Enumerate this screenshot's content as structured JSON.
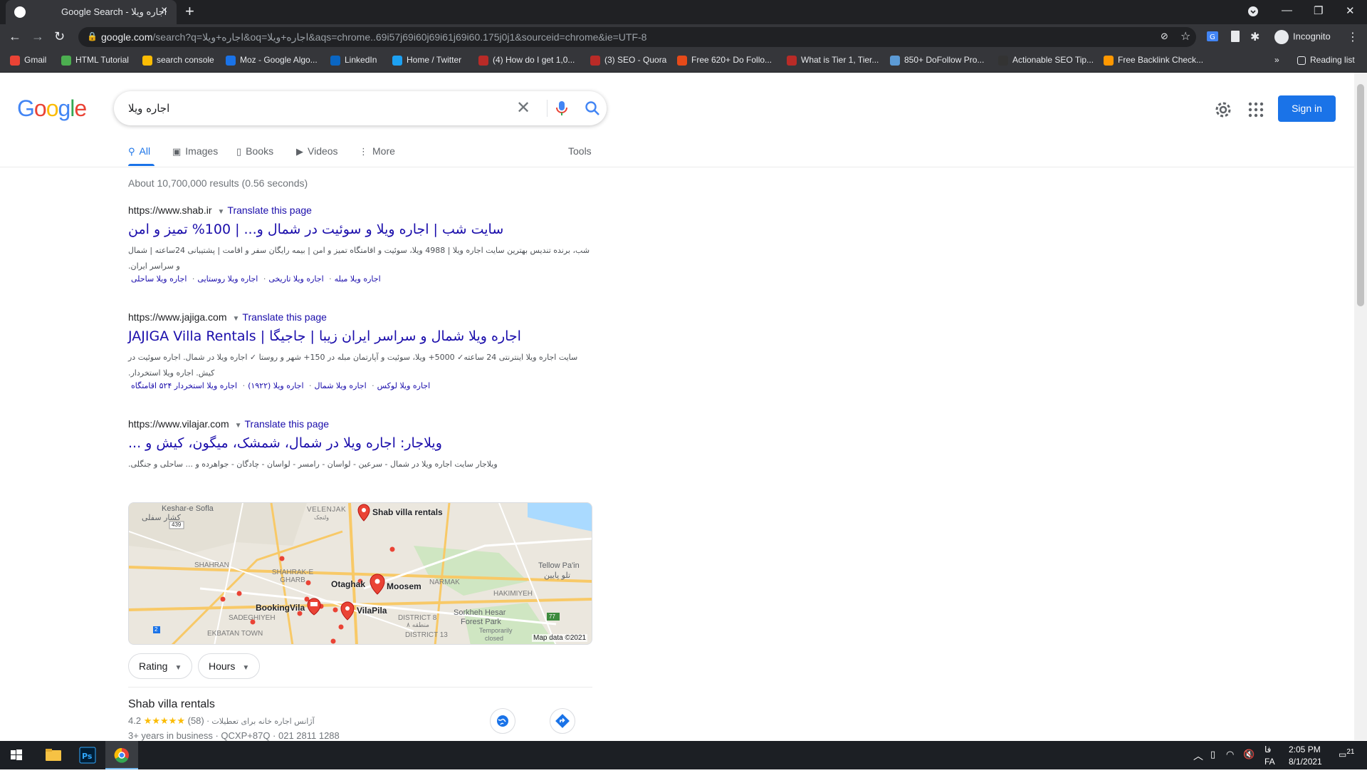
{
  "browser": {
    "tab_title": "Google Search - اجاره ویلا",
    "new_tab": "+",
    "url_host": "google.com",
    "url_rest": "/search?q=اجاره+ویلا&oq=اجاره+ویلا&aqs=chrome..69i57j69i60j69i61j69i60.175j0j1&sourceid=chrome&ie=UTF-8",
    "incognito_label": "Incognito",
    "bookmarks": [
      {
        "label": "Gmail",
        "color": "#ea4335"
      },
      {
        "label": "HTML Tutorial",
        "color": "#4caf50"
      },
      {
        "label": "search console",
        "color": "#fbbc04"
      },
      {
        "label": "Moz - Google Algo...",
        "color": "#1a73e8"
      },
      {
        "label": "LinkedIn",
        "color": "#0a66c2"
      },
      {
        "label": "Home / Twitter",
        "color": "#1da1f2"
      },
      {
        "label": "(4) How do I get 1,0...",
        "color": "#b92b27"
      },
      {
        "label": "(3) SEO - Quora",
        "color": "#b92b27"
      },
      {
        "label": "Free 620+ Do Follo...",
        "color": "#e64a19"
      },
      {
        "label": "What is Tier 1, Tier...",
        "color": "#b92b27"
      },
      {
        "label": "850+ DoFollow Pro...",
        "color": "#5c9bd6"
      },
      {
        "label": "Actionable SEO Tip...",
        "color": "#333333"
      },
      {
        "label": "Free Backlink Check...",
        "color": "#ff9800"
      }
    ],
    "bookmarks_more": "»",
    "reading_list": "Reading list"
  },
  "google": {
    "logo_letters": [
      "G",
      "o",
      "o",
      "g",
      "l",
      "e"
    ],
    "query": "اجاره ویلا",
    "sign_in": "Sign in",
    "tabs": [
      {
        "label": "All",
        "icon": "search-icon"
      },
      {
        "label": "Images",
        "icon": "image-icon"
      },
      {
        "label": "Books",
        "icon": "book-icon"
      },
      {
        "label": "Videos",
        "icon": "video-icon"
      },
      {
        "label": "More",
        "icon": "more-vert-icon"
      }
    ],
    "tools": "Tools",
    "stats": "About 10,700,000 results (0.56 seconds)"
  },
  "results": [
    {
      "url": "https://www.shab.ir",
      "translate": "Translate this page",
      "title": "سایت شب | اجاره ویلا و سوئیت در شمال و... | 100% تمیز و امن",
      "snippet": "شب، برنده تندیس بهترین سایت اجاره ویلا | 4988 ویلا، سوئیت و اقامتگاه تمیز و امن | بیمه رایگان سفر و اقامت | پشتیبانی 24ساعته | شمال و سراسر ایران.",
      "sitelinks": [
        "اجاره ویلا مبله",
        "اجاره ویلا تاریخی",
        "اجاره ویلا روستایی",
        "اجاره ویلا ساحلی"
      ]
    },
    {
      "url": "https://www.jajiga.com",
      "translate": "Translate this page",
      "title": "اجاره ویلا شمال و سراسر ایران زیبا | جاجیگا | JAJIGA Villa Rentals",
      "snippet": "سایت اجاره ویلا اینترنتی 24 ساعته✓ 5000+ ویلا، سوئیت و آپارتمان مبله در 150+ شهر و روستا ✓ اجاره ویلا در شمال. اجاره سوئیت در کیش. اجاره ویلا استخردار.",
      "sitelinks": [
        "اجاره ویلا لوکس",
        "اجاره ویلا شمال",
        "اجاره ویلا (۱۹۲۲)",
        "اجاره ویلا استخردار ۵۲۴ اقامتگاه"
      ]
    },
    {
      "url": "https://www.vilajar.com",
      "translate": "Translate this page",
      "title": "ویلاجار: اجاره ویلا در شمال، شمشک، میگون، کیش و ...",
      "snippet": "ویلاجار سایت اجاره ویلا در شمال - سرعین - لواسان - رامسر - لواسان - چادگان - جواهرده و ... ساحلی و جنگلی.",
      "sitelinks": []
    }
  ],
  "map": {
    "labels": {
      "keshar_en": "Keshar-e Sofla",
      "keshar_fa": "کشار سفلی",
      "road439": "439",
      "velenjak": "VELENJAK",
      "velenjak_fa": "ولنجک",
      "shab": "Shab villa rentals",
      "shahran": "SHAHRAN",
      "shahrak": "SHAHRAK-E GHARB",
      "otaghak": "Otaghak",
      "moosem": "Moosem",
      "narmak": "NARMAK",
      "hakimiyeh": "HAKIMIYEH",
      "tellow": "Tellow Pa'in",
      "tellow_fa": "تلو پایین",
      "bookingvila": "BookingVila",
      "vilapila": "VilaPila",
      "sadeghiyeh": "SADEGHIYEH",
      "ekbatan": "EKBATAN TOWN",
      "district8": "DISTRICT 8",
      "district8_fa": "منطقه ۸",
      "district13": "DISTRICT 13",
      "sorkheh": "Sorkheh Hesar",
      "forest": "Forest Park",
      "temp": "Temporarily",
      "closed": "closed",
      "road77": "77",
      "road2": "2",
      "mapdata": "Map data ©2021"
    }
  },
  "chips": [
    {
      "label": "Rating"
    },
    {
      "label": "Hours"
    }
  ],
  "business": {
    "name": "Shab villa rentals",
    "rating": "4.2",
    "stars": "★★★★★",
    "reviews": "(58)",
    "category": "· آژانس اجاره خانه برای تعطیلات",
    "info": "3+ years in business · QCXP+87Q · 021 2811 1288"
  },
  "taskbar": {
    "lang1": "فا",
    "lang2": "FA",
    "time": "2:05 PM",
    "date": "8/1/2021",
    "notif": "21"
  }
}
